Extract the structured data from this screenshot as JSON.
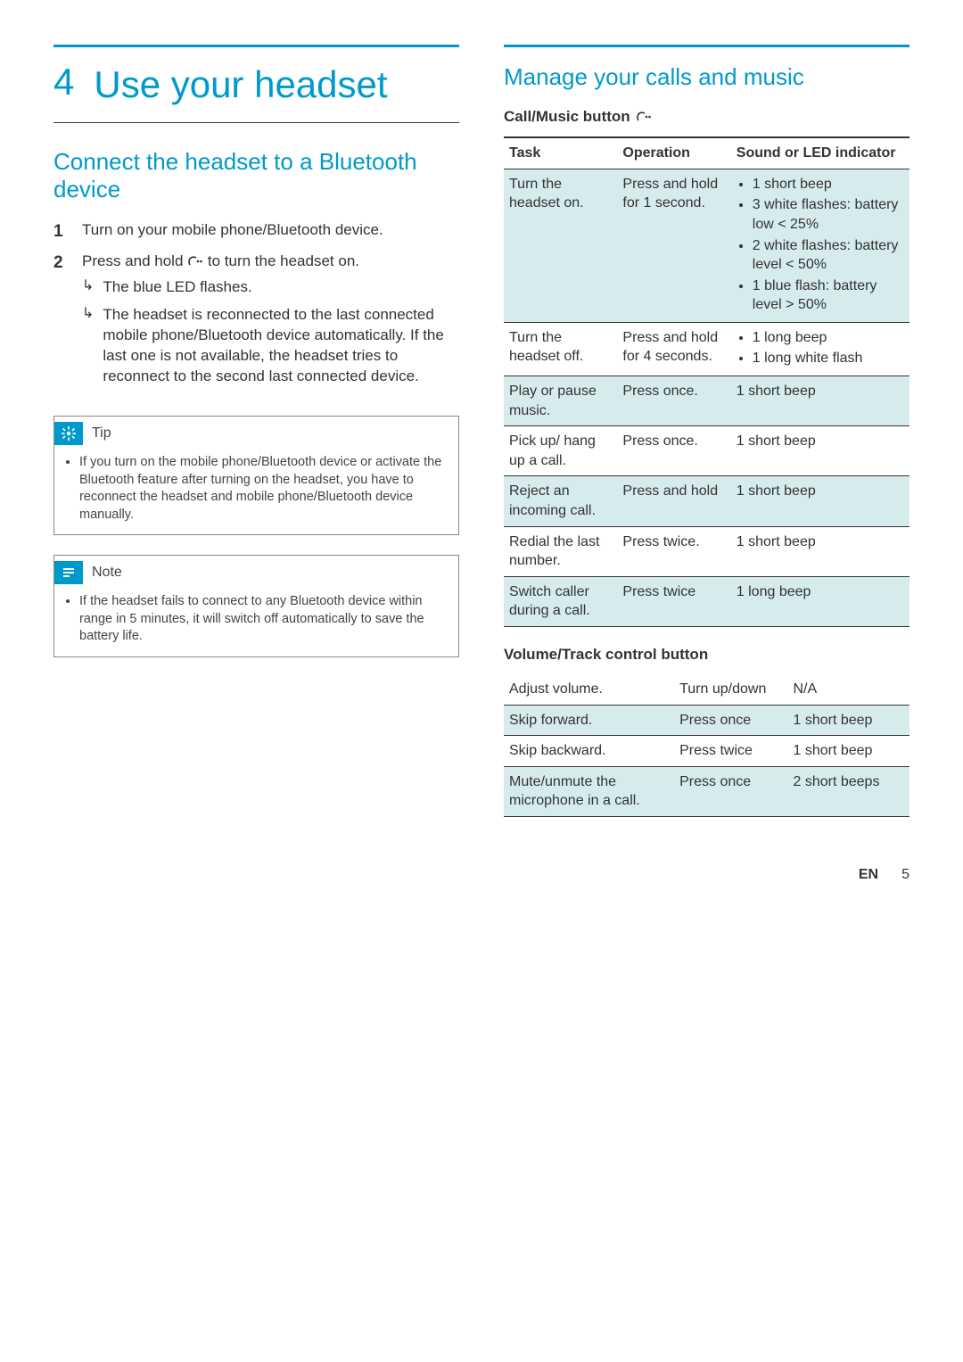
{
  "chapter": {
    "number": "4",
    "title": "Use your headset"
  },
  "left": {
    "section_title": "Connect the headset to a Bluetooth device",
    "steps": {
      "s1": "Turn on your mobile phone/Bluetooth device.",
      "s2": "Press and hold      to turn the headset on.",
      "s2_sub1": "The blue LED flashes.",
      "s2_sub2": "The headset is reconnected to the last connected mobile phone/Bluetooth device automatically. If the last one is not available, the headset tries to reconnect to the second last connected device."
    },
    "tip": {
      "label": "Tip",
      "text": "If you turn on the mobile phone/Bluetooth device or activate the Bluetooth feature after turning on the headset, you have to reconnect the headset and mobile phone/Bluetooth device manually."
    },
    "note": {
      "label": "Note",
      "text": "If the headset fails to connect to any Bluetooth device within range in 5 minutes, it will switch off automatically to save the battery life."
    }
  },
  "right": {
    "section_title": "Manage your calls and music",
    "subsection1": "Call/Music button",
    "table1": {
      "headers": {
        "c1": "Task",
        "c2": "Operation",
        "c3": "Sound or LED indicator"
      },
      "rows": [
        {
          "task": "Turn the headset on.",
          "op": "Press and hold for 1 second.",
          "ind_bullets": [
            "1 short beep",
            "3 white flashes: battery low < 25%",
            "2 white flashes: battery level < 50%",
            "1 blue flash: battery level > 50%"
          ],
          "shade": true
        },
        {
          "task": "Turn the headset off.",
          "op": "Press and hold for 4 seconds.",
          "ind_bullets": [
            "1 long beep",
            "1 long white flash"
          ],
          "shade": false
        },
        {
          "task": "Play or pause music.",
          "op": "Press once.",
          "ind": "1 short beep",
          "shade": true
        },
        {
          "task": "Pick up/ hang up a call.",
          "op": "Press once.",
          "ind": "1 short beep",
          "shade": false
        },
        {
          "task": "Reject an incoming call.",
          "op": "Press and hold",
          "ind": "1 short beep",
          "shade": true
        },
        {
          "task": "Redial the last number.",
          "op": "Press twice.",
          "ind": "1 short beep",
          "shade": false
        },
        {
          "task": "Switch caller during a call.",
          "op": "Press twice",
          "ind": "1 long beep",
          "shade": true
        }
      ]
    },
    "subsection2": "Volume/Track control button",
    "table2": {
      "rows": [
        {
          "task": "Adjust volume.",
          "op": "Turn up/down",
          "ind": "N/A",
          "shade": false
        },
        {
          "task": "Skip forward.",
          "op": "Press once",
          "ind": "1 short beep",
          "shade": true
        },
        {
          "task": "Skip backward.",
          "op": "Press twice",
          "ind": "1 short beep",
          "shade": false
        },
        {
          "task": "Mute/unmute the microphone in a call.",
          "op": "Press once",
          "ind": "2 short beeps",
          "shade": true
        }
      ]
    }
  },
  "footer": {
    "lang": "EN",
    "page": "5"
  }
}
